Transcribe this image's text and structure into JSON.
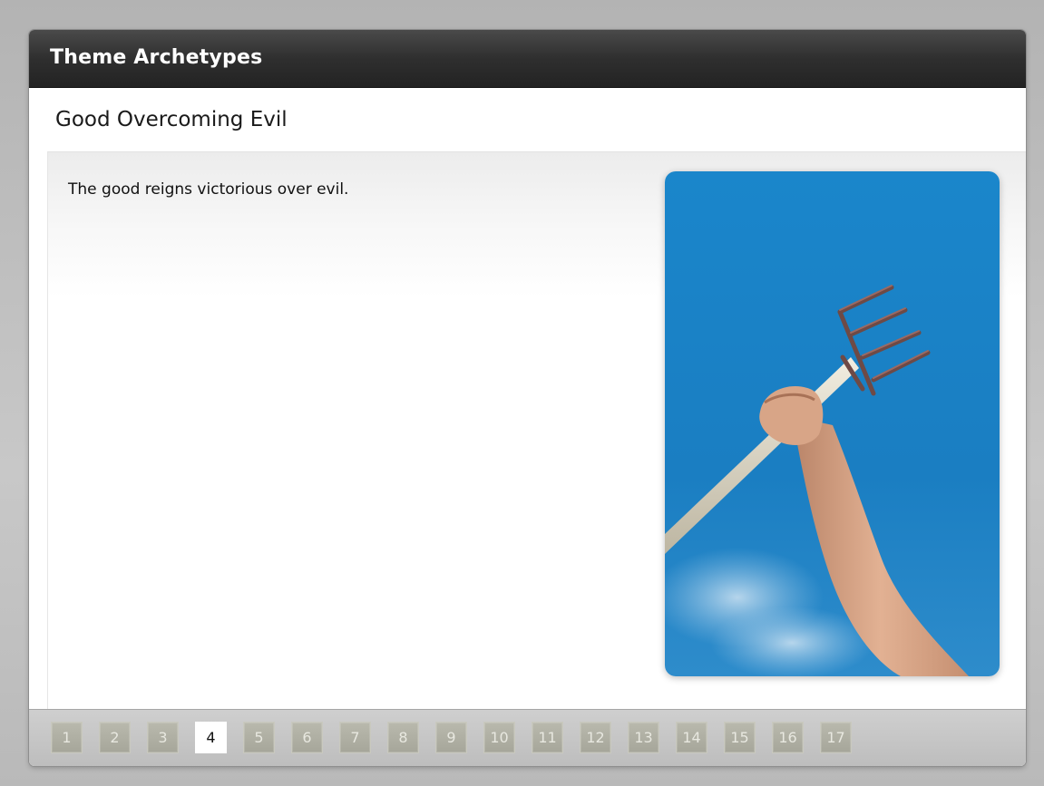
{
  "header": {
    "title": "Theme Archetypes"
  },
  "slide": {
    "title": "Good Overcoming Evil",
    "body": "The good reigns victorious over evil.",
    "image_icon": "raised-pitchfork-photo"
  },
  "pager": {
    "current": "4",
    "pages": [
      "1",
      "2",
      "3",
      "4",
      "5",
      "6",
      "7",
      "8",
      "9",
      "10",
      "11",
      "12",
      "13",
      "14",
      "15",
      "16",
      "17"
    ]
  },
  "colors": {
    "titlebar": "#2f2f2f",
    "sky": "#1b7fc4",
    "active_page": "#ffffff",
    "inactive_page": "#aeaea2"
  }
}
